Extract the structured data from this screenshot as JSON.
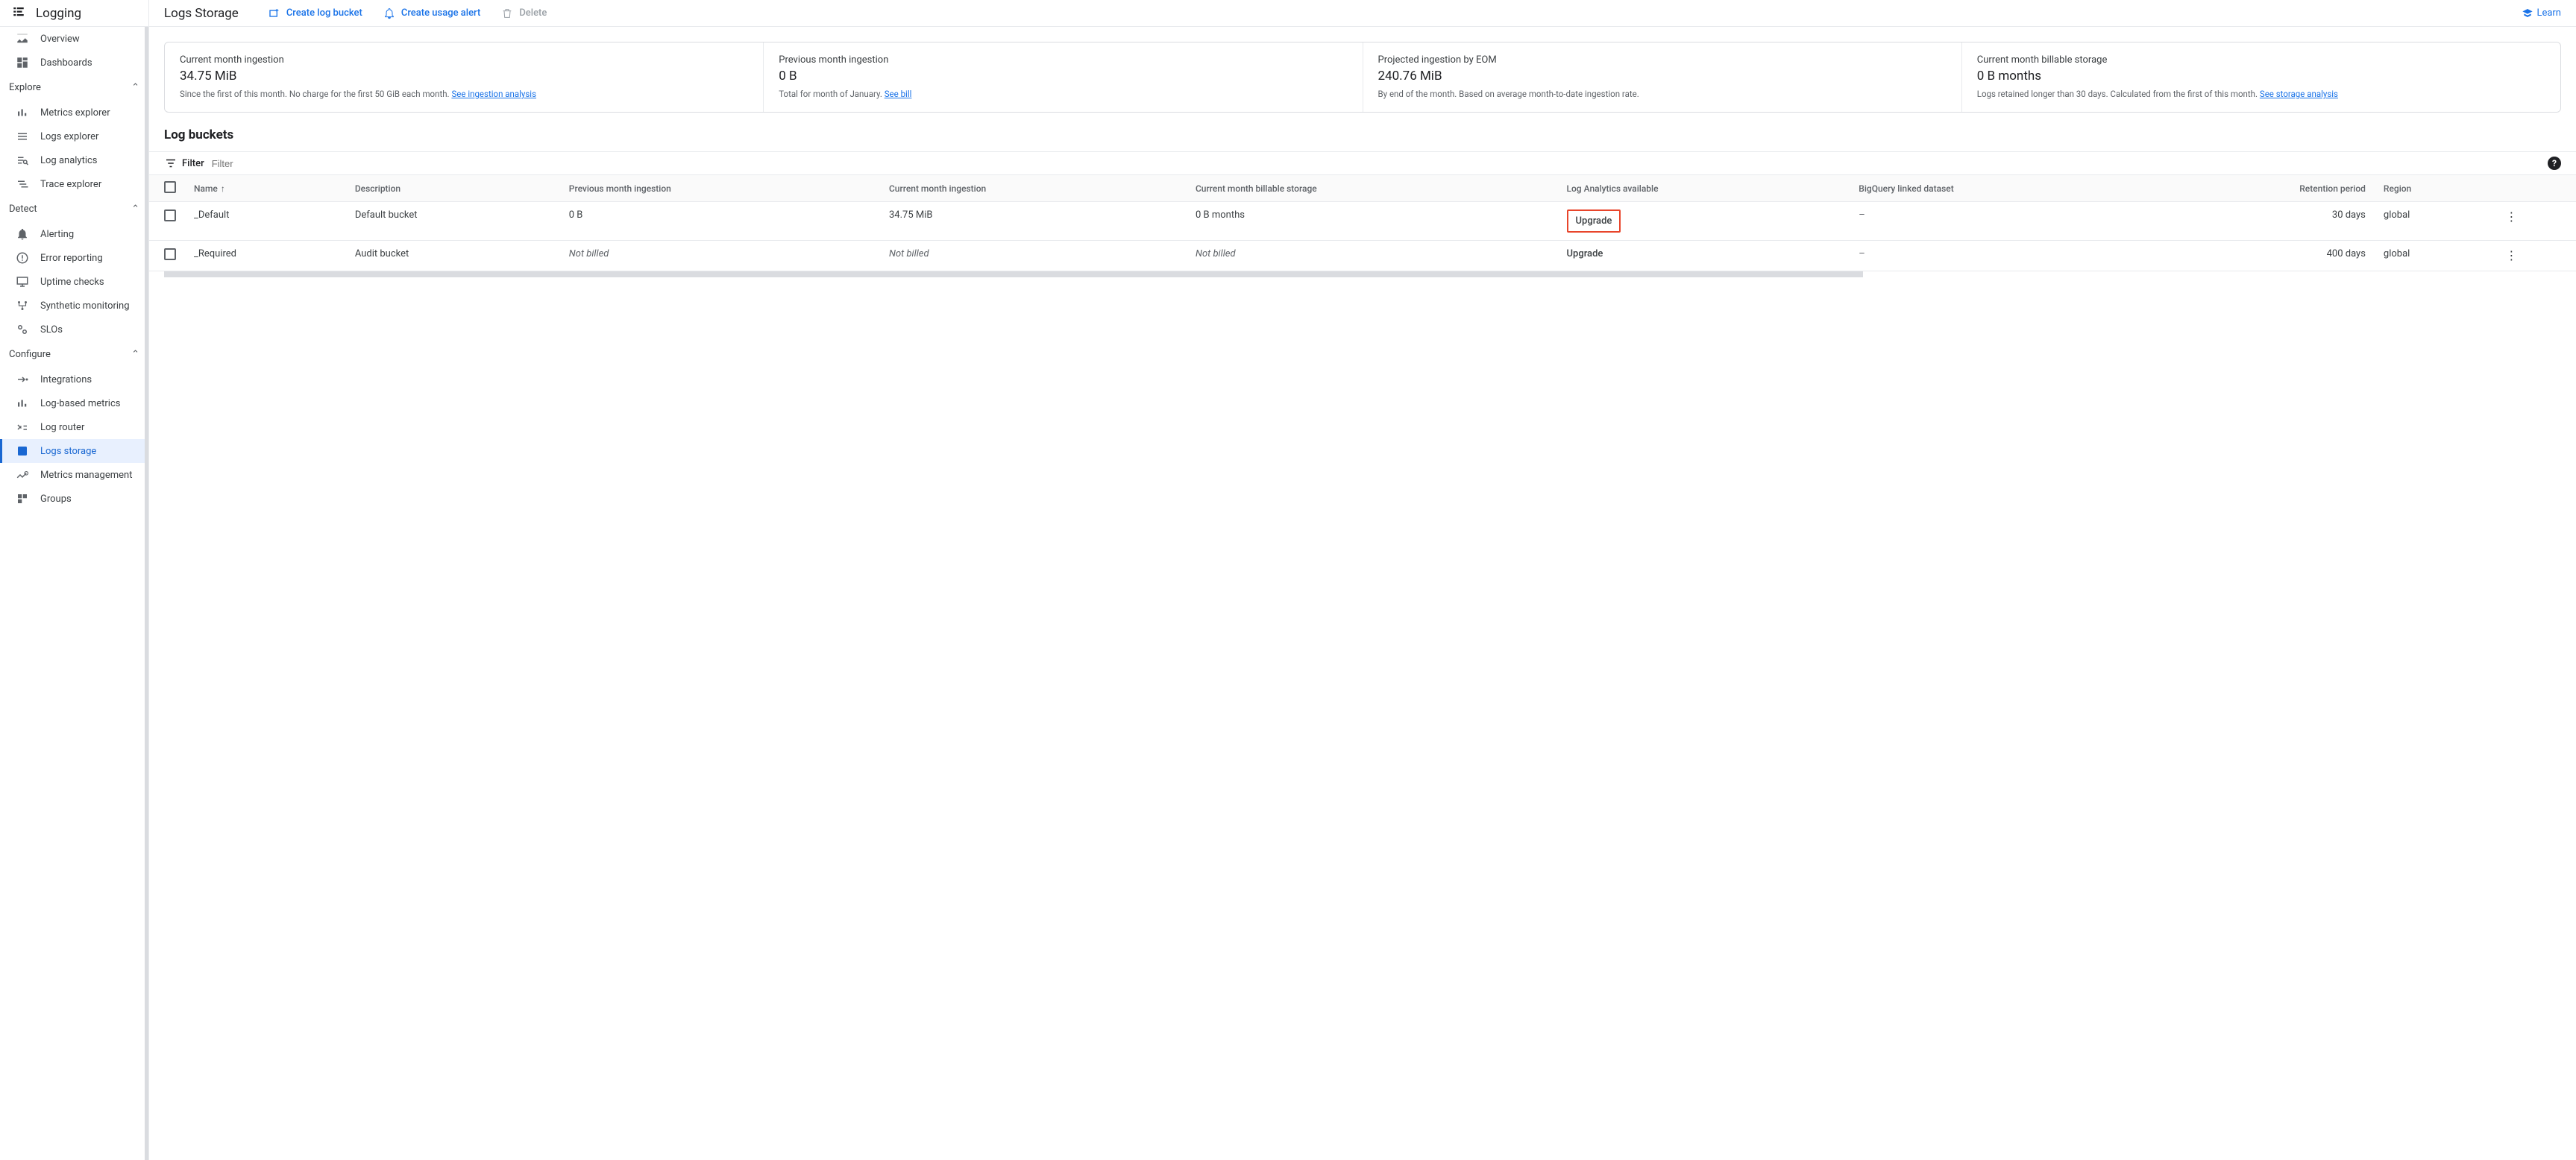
{
  "app": {
    "title": "Logging"
  },
  "sidebar": {
    "top": [
      {
        "label": "Overview"
      },
      {
        "label": "Dashboards"
      }
    ],
    "sections": [
      {
        "title": "Explore",
        "items": [
          {
            "label": "Metrics explorer"
          },
          {
            "label": "Logs explorer"
          },
          {
            "label": "Log analytics"
          },
          {
            "label": "Trace explorer"
          }
        ]
      },
      {
        "title": "Detect",
        "items": [
          {
            "label": "Alerting"
          },
          {
            "label": "Error reporting"
          },
          {
            "label": "Uptime checks"
          },
          {
            "label": "Synthetic monitoring"
          },
          {
            "label": "SLOs"
          }
        ]
      },
      {
        "title": "Configure",
        "items": [
          {
            "label": "Integrations"
          },
          {
            "label": "Log-based metrics"
          },
          {
            "label": "Log router"
          },
          {
            "label": "Logs storage",
            "active": true
          },
          {
            "label": "Metrics management"
          },
          {
            "label": "Groups"
          }
        ]
      }
    ]
  },
  "header": {
    "title": "Logs Storage",
    "create_bucket": "Create log bucket",
    "create_alert": "Create usage alert",
    "delete": "Delete",
    "learn": "Learn"
  },
  "stats": [
    {
      "label": "Current month ingestion",
      "value": "34.75 MiB",
      "note_a": "Since the first of this month. No charge for the first 50 GiB each month. ",
      "link": "See ingestion analysis"
    },
    {
      "label": "Previous month ingestion",
      "value": "0 B",
      "note_a": "Total for month of January. ",
      "link": "See bill"
    },
    {
      "label": "Projected ingestion by EOM",
      "value": "240.76 MiB",
      "note_a": "By end of the month. Based on average month-to-date ingestion rate.",
      "link": ""
    },
    {
      "label": "Current month billable storage",
      "value": "0 B months",
      "note_a": "Logs retained longer than 30 days. Calculated from the first of this month. ",
      "link": "See storage analysis"
    }
  ],
  "section_title": "Log buckets",
  "filter": {
    "label": "Filter",
    "placeholder": "Filter"
  },
  "table": {
    "columns": {
      "name": "Name",
      "description": "Description",
      "prev": "Previous month ingestion",
      "curr": "Current month ingestion",
      "billable": "Current month billable storage",
      "analytics": "Log Analytics available",
      "bigquery": "BigQuery linked dataset",
      "retention": "Retention period",
      "region": "Region"
    },
    "rows": [
      {
        "name": "_Default",
        "description": "Default bucket",
        "prev": "0 B",
        "curr": "34.75 MiB",
        "billable": "0 B months",
        "analytics": "Upgrade",
        "bigquery": "–",
        "retention": "30 days",
        "region": "global",
        "highlight": true
      },
      {
        "name": "_Required",
        "description": "Audit bucket",
        "prev": "Not billed",
        "curr": "Not billed",
        "billable": "Not billed",
        "analytics": "Upgrade",
        "bigquery": "–",
        "retention": "400 days",
        "region": "global",
        "italic": true
      }
    ]
  }
}
